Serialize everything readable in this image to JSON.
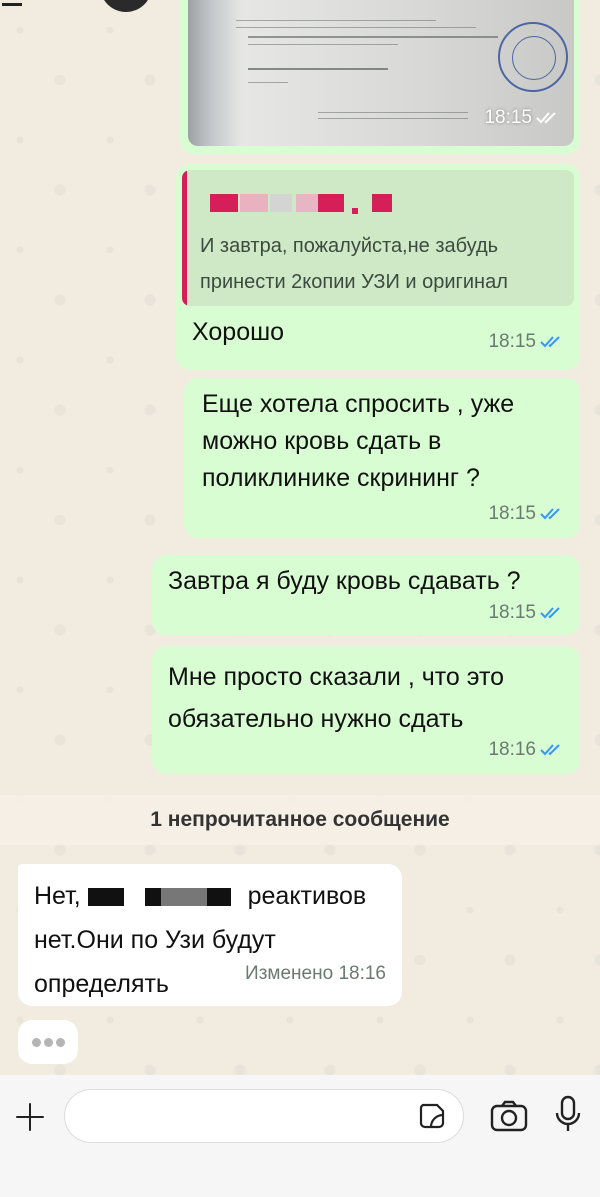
{
  "messages": {
    "image": {
      "time": "18:15"
    },
    "reply": {
      "quoted_text": "И завтра, пожалуйста,не забудь принести 2копии УЗИ и оригинал",
      "text": "Хорошо",
      "time": "18:15"
    },
    "msg3": {
      "text": "Еще хотела спросить , уже можно кровь сдать в поликлинике скрининг ?",
      "time": "18:15"
    },
    "msg4": {
      "text": "Завтра я буду кровь сдавать ?",
      "time": "18:15"
    },
    "msg5": {
      "text": "Мне просто сказали , что это обязательно нужно сдать",
      "time": "18:16"
    }
  },
  "unread_banner": "1 непрочитанное сообщение",
  "incoming": {
    "prefix": "Нет,",
    "middle": "реактивов",
    "rest": "нет.Они по Узи будут определять",
    "edited_label": "Изменено",
    "time": "18:16"
  },
  "composer": {
    "placeholder": ""
  },
  "colors": {
    "outgoing_bubble": "#d9fdd3",
    "incoming_bubble": "#ffffff",
    "read_check": "#3497f9",
    "quote_bar": "#d61e58"
  },
  "icons": [
    "plus-icon",
    "sticker-icon",
    "camera-icon",
    "mic-icon",
    "double-check-icon"
  ]
}
